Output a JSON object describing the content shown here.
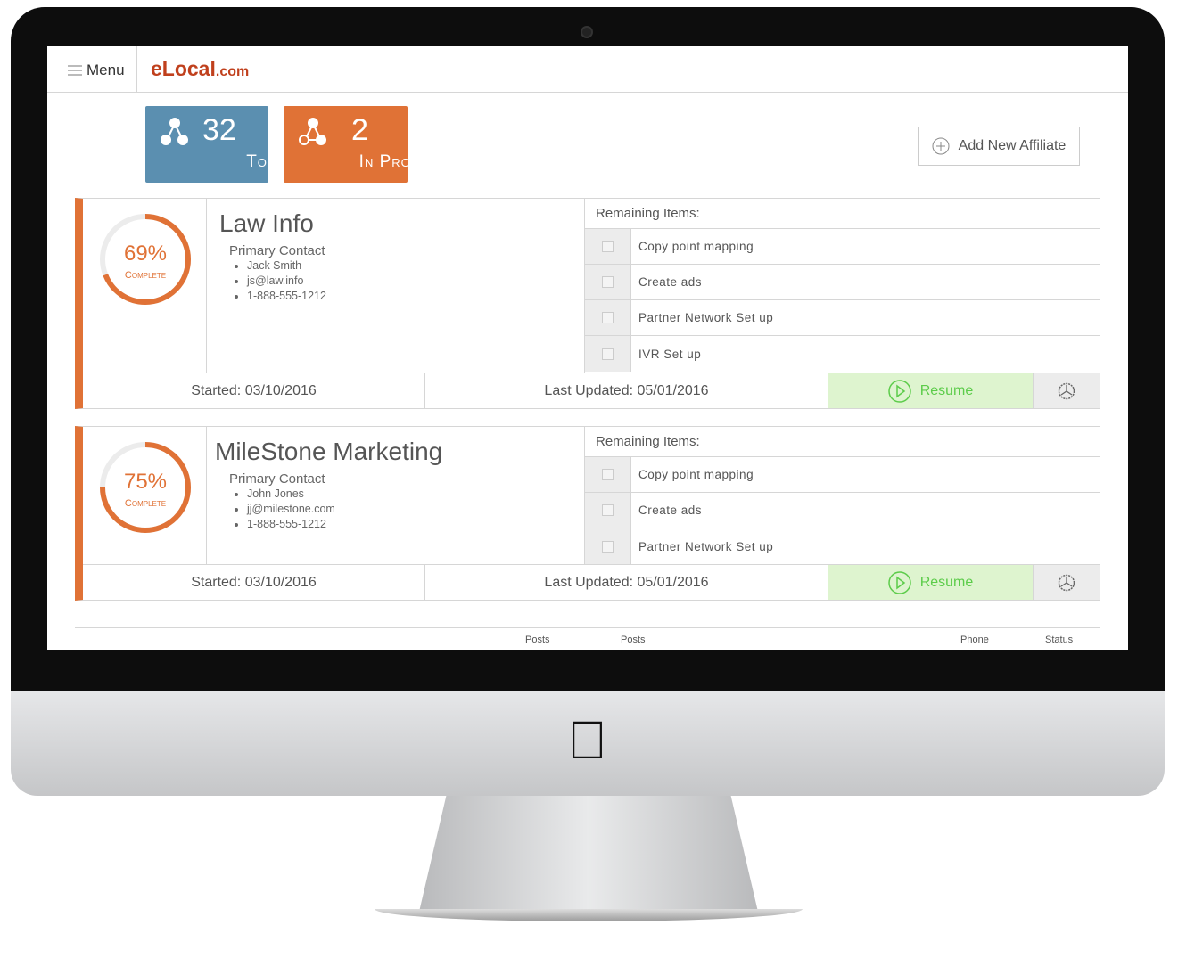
{
  "header": {
    "menu_label": "Menu",
    "logo_main": "eLocal",
    "logo_suffix": ".com"
  },
  "stats": [
    {
      "value": "32",
      "label": "Total",
      "color": "#5b8fb0"
    },
    {
      "value": "2",
      "label": "In Progress",
      "color": "#e07236"
    }
  ],
  "add_affiliate_label": "Add New Affiliate",
  "cards": [
    {
      "name": "Law Info",
      "percent": "69%",
      "percent_value": 69,
      "complete_label": "Complete",
      "contact_heading": "Primary Contact",
      "contact_name": "Jack Smith",
      "contact_email": "js@law.info",
      "contact_phone": "1-888-555-1212",
      "remaining_heading": "Remaining Items:",
      "items": [
        "Copy point mapping",
        "Create  ads",
        "Partner Network Set up",
        "IVR Set up"
      ],
      "started": "Started: 03/10/2016",
      "last_updated": "Last Updated: 05/01/2016",
      "resume_label": "Resume"
    },
    {
      "name": "MileStone Marketing",
      "percent": "75%",
      "percent_value": 75,
      "complete_label": "Complete",
      "contact_heading": "Primary Contact",
      "contact_name": "John Jones",
      "contact_email": "jj@milestone.com",
      "contact_phone": "1-888-555-1212",
      "remaining_heading": "Remaining Items:",
      "items": [
        "Copy point mapping",
        "Create  ads",
        "Partner Network Set up"
      ],
      "started": "Started: 03/10/2016",
      "last_updated": "Last Updated: 05/01/2016",
      "resume_label": "Resume"
    }
  ],
  "table_headers": [
    "Posts",
    "Posts",
    "Phone",
    "Status"
  ],
  "colors": {
    "accent": "#e07236",
    "blue": "#5b8fb0",
    "resume_bg": "#def4cf",
    "resume_text": "#5ccc4a"
  }
}
